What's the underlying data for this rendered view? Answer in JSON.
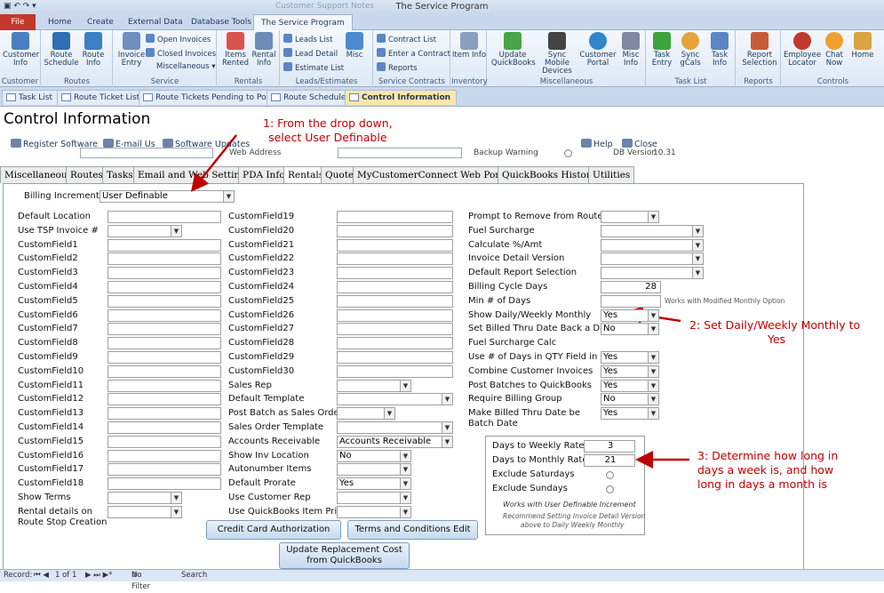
{
  "window": {
    "title": "The Service Program",
    "ghost_tab": "Customer Support Notes"
  },
  "ribbon_tabs": [
    {
      "label": "File"
    },
    {
      "label": "Home"
    },
    {
      "label": "Create"
    },
    {
      "label": "External Data"
    },
    {
      "label": "Database Tools"
    },
    {
      "label": "The Service Program"
    }
  ],
  "ribbon": {
    "customer": {
      "btn": "Customer Info",
      "group": "Customer"
    },
    "routes": {
      "schedule": "Route Schedule",
      "info": "Route Info",
      "group": "Routes"
    },
    "service": {
      "invoice": "Invoice Entry",
      "open": "Open Invoices",
      "closed": "Closed Invoices",
      "misc": "Miscellaneous",
      "group": "Service"
    },
    "rentals": {
      "items": "Items Rented",
      "info": "Rental Info",
      "group": "Rentals"
    },
    "leads": {
      "list": "Leads List",
      "detail": "Lead Detail",
      "estimate": "Estimate List",
      "misc": "Misc",
      "group": "Leads/Estimates"
    },
    "contracts": {
      "list": "Contract List",
      "enter": "Enter a Contract",
      "reports": "Reports",
      "group": "Service Contracts"
    },
    "inventory": {
      "item": "Item Info",
      "group": "Inventory"
    },
    "misc": {
      "qb": "Update QuickBooks",
      "sync": "Sync Mobile Devices",
      "portal": "Customer Portal",
      "misc": "Misc Info",
      "group": "Miscellaneous"
    },
    "tasks": {
      "entry": "Task Entry",
      "gcals": "Sync gCals",
      "info": "Task Info",
      "group": "Task List"
    },
    "reports": {
      "sel": "Report Selection",
      "group": "Reports"
    },
    "controls": {
      "emp": "Employee Locator",
      "chat": "Chat Now",
      "home": "Home",
      "group": "Controls"
    }
  },
  "doc_tabs": [
    "Task List",
    "Route Ticket List",
    "Route Tickets Pending to Post",
    "Route Schedule",
    "Control Information"
  ],
  "form": {
    "title": "Control Information",
    "links": {
      "register": "Register Software",
      "email": "E-mail Us",
      "updates": "Software Updates",
      "help": "Help",
      "close": "Close"
    },
    "hidden": {
      "web": "Web Address",
      "backup": "Backup Warning",
      "db": "DB Version",
      "db_value": "10.31"
    }
  },
  "form_tabs": [
    "Miscellaneous",
    "Routes",
    "Tasks",
    "Email and Web Settings",
    "PDA Info",
    "Rentals",
    "Quote",
    "MyCustomerConnect Web Portal",
    "QuickBooks History",
    "Utilities"
  ],
  "rentals": {
    "billing_increment_label": "Billing Increment",
    "billing_increment_value": "User Definable",
    "col1": [
      "Default Location",
      "Use TSP Invoice #",
      "CustomField1",
      "CustomField2",
      "CustomField3",
      "CustomField4",
      "CustomField5",
      "CustomField6",
      "CustomField7",
      "CustomField8",
      "CustomField9",
      "CustomField10",
      "CustomField11",
      "CustomField12",
      "CustomField13",
      "CustomField14",
      "CustomField15",
      "CustomField16",
      "CustomField17",
      "CustomField18",
      "Show Terms",
      "Rental details on"
    ],
    "col1_extra": "Route Stop Creation",
    "col2": [
      "CustomField19",
      "CustomField20",
      "CustomField21",
      "CustomField22",
      "CustomField23",
      "CustomField24",
      "CustomField25",
      "CustomField26",
      "CustomField27",
      "CustomField28",
      "CustomField29",
      "CustomField30",
      "Sales Rep",
      "Default Template",
      "Post Batch as Sales Orders",
      "Sales Order Template",
      "Accounts Receivable",
      "Show Inv Location",
      "Autonumber Items",
      "Default Prorate",
      "Use Customer Rep",
      "Use QuickBooks Item Price"
    ],
    "col2_values": {
      "accounts_receivable": "Accounts Receivable",
      "show_inv_location": "No",
      "default_prorate": "Yes"
    },
    "col3": [
      "Prompt to Remove from Route",
      "Fuel Surcharge",
      "Calculate %/Amt",
      "Invoice Detail Version",
      "Default Report Selection",
      "Billing Cycle Days",
      "Min # of Days",
      "Show Daily/Weekly Monthly",
      "Set Billed Thru Date Back a Day",
      "Fuel Surcharge Calc",
      "Use # of Days in QTY Field in QB",
      "Combine Customer Invoices",
      "Post Batches to QuickBooks",
      "Require Billing Group",
      "Make Billed Thru Date be"
    ],
    "col3_extra": "Batch Date",
    "col3_values": {
      "billing_cycle_days": "28",
      "show_daily": "Yes",
      "set_billed": "No",
      "use_days": "Yes",
      "combine": "Yes",
      "post_batches": "Yes",
      "require_group": "No",
      "make_billed": "Yes"
    },
    "col3_note": "Works with Modified Monthly Option",
    "rate_box": {
      "days_weekly_label": "Days to Weekly Rate",
      "days_weekly": "3",
      "days_monthly_label": "Days to Monthly Rate",
      "days_monthly": "21",
      "exclude_sat": "Exclude Saturdays",
      "exclude_sun": "Exclude Sundays",
      "note1": "Works with User Definable Increment",
      "note2a": "Recommend Setting Invoice Detail Version",
      "note2b": "above to Daily Weekly Monthly"
    },
    "buttons": {
      "cc": "Credit Card Authorization",
      "terms": "Terms and Conditions Edit",
      "update1": "Update Replacement Cost",
      "update2": "from QuickBooks"
    }
  },
  "annotations": {
    "a1_line1": "1: From the drop down,",
    "a1_line2": "select User Definable",
    "a2_line1": "2: Set Daily/Weekly Monthly to",
    "a2_line2": "Yes",
    "a3_line1": "3: Determine how long in",
    "a3_line2": "days a week is, and how",
    "a3_line3": "long in days a month is"
  },
  "status": {
    "record": "Record:",
    "pos": "1 of 1",
    "filter": "No Filter",
    "search": "Search"
  }
}
